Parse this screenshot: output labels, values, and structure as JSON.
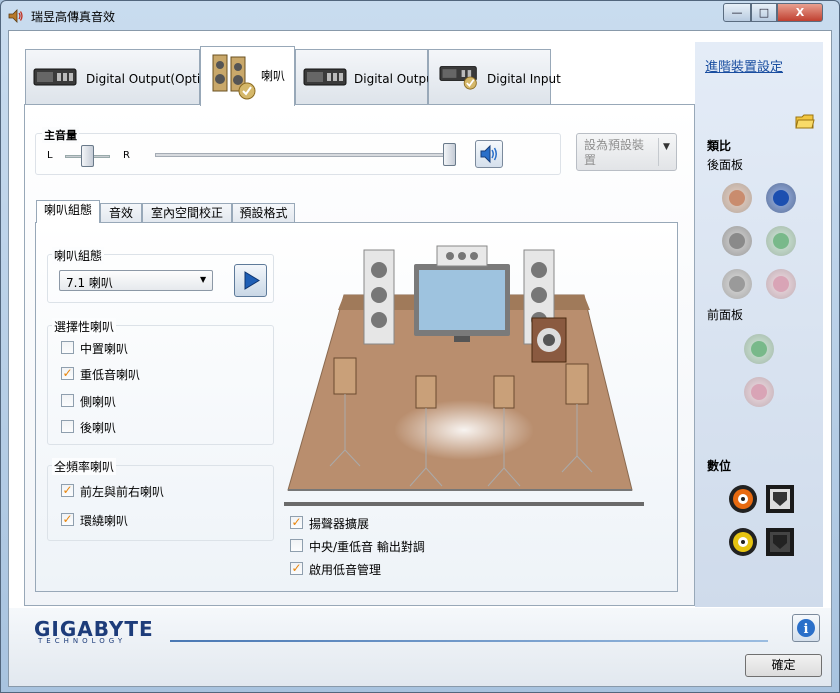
{
  "window": {
    "title": "瑞昱高傳真音效",
    "min_label": "—",
    "max_label": "□",
    "close_label": "X"
  },
  "device_tabs": [
    {
      "label": "Digital Output(Optical)",
      "icon": "optical-output-icon"
    },
    {
      "label": "喇叭",
      "icon": "speaker-icon"
    },
    {
      "label": "Digital Output",
      "icon": "digital-output-icon"
    },
    {
      "label": "Digital Input",
      "icon": "digital-input-icon"
    }
  ],
  "volume": {
    "title": "主音量",
    "left": "L",
    "right": "R",
    "balance": 0.5,
    "level": 1.0
  },
  "default_device": {
    "label": "設為預設裝置"
  },
  "sub_tabs": [
    "喇叭組態",
    "音效",
    "室內空間校正",
    "預設格式"
  ],
  "config": {
    "group_title": "喇叭組態",
    "selected": "7.1 喇叭",
    "optional_title": "選擇性喇叭",
    "optional": [
      {
        "label": "中置喇叭",
        "checked": false
      },
      {
        "label": "重低音喇叭",
        "checked": true
      },
      {
        "label": "側喇叭",
        "checked": false
      },
      {
        "label": "後喇叭",
        "checked": false
      }
    ],
    "fullrange_title": "全頻率喇叭",
    "fullrange": [
      {
        "label": "前左與前右喇叭",
        "checked": true
      },
      {
        "label": "環繞喇叭",
        "checked": true
      }
    ],
    "options": [
      {
        "label": "揚聲器擴展",
        "checked": true
      },
      {
        "label": "中央/重低音 輸出對調",
        "checked": false
      },
      {
        "label": "啟用低音管理",
        "checked": true
      }
    ]
  },
  "sidebar": {
    "advanced_link": "進階裝置設定",
    "analog": "類比",
    "rear_panel": "後面板",
    "front_panel": "前面板",
    "digital": "數位",
    "jack_colors": {
      "orange": "#c98c6e",
      "blue": "#1c4fb0",
      "gray": "#8a8a8a",
      "green": "#79b98a",
      "pink": "#d9a4b6"
    }
  },
  "footer": {
    "logo": "GIGABYTE",
    "logo_sub": "TECHNOLOGY",
    "ok_label": "確定",
    "info_label": "i"
  }
}
